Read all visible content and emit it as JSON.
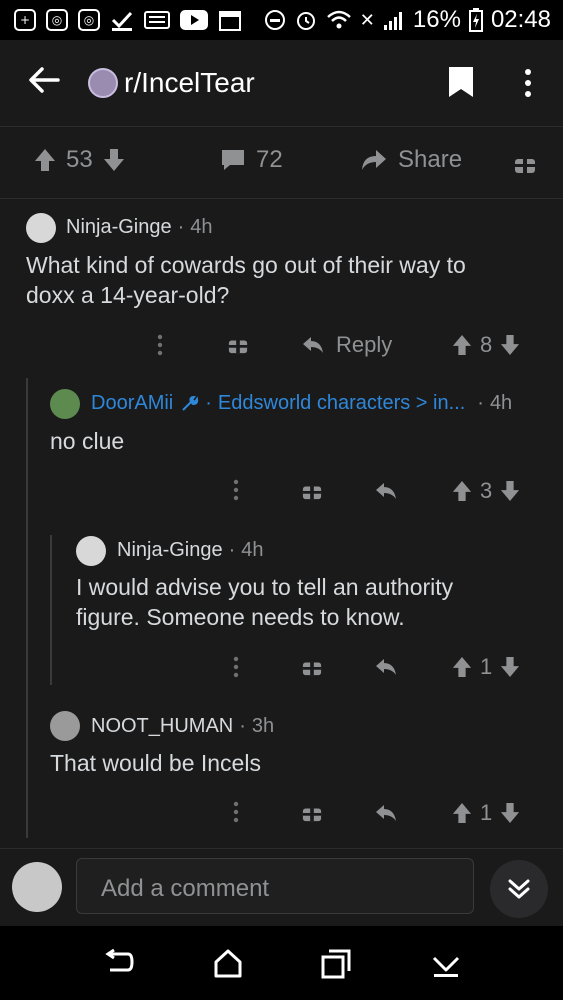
{
  "status_bar": {
    "battery": "16%",
    "time": "02:48",
    "x_mark": "✕"
  },
  "header": {
    "subreddit": "r/IncelTear",
    "bookmark_icon": "bookmark-icon",
    "more_icon": "more-icon"
  },
  "post_actions": {
    "upvotes": "53",
    "comments": "72",
    "share": "Share"
  },
  "comments": [
    {
      "author": "Ninja-Ginge",
      "sep": "·",
      "time": "4h",
      "body_lines": [
        "What kind of cowards go out of their way to",
        "doxx a 14-year-old?"
      ],
      "reply_label": "Reply",
      "score": "8"
    },
    {
      "author": "DoorAMii",
      "sep": "·",
      "flair": "Eddsworld characters > in...",
      "time": "4h",
      "body_lines": [
        "no clue"
      ],
      "score": "3"
    },
    {
      "author": "Ninja-Ginge",
      "sep": "·",
      "time": "4h",
      "body_lines": [
        "I would advise you to tell an authority",
        "figure. Someone needs to know."
      ],
      "score": "1"
    },
    {
      "author": "NOOT_HUMAN",
      "sep": "·",
      "time": "3h",
      "body_lines": [
        "That would be Incels"
      ],
      "score": "1"
    }
  ],
  "composer": {
    "placeholder": "Add a comment"
  },
  "colors": {
    "background": "#1a1a1b",
    "text": "#d7dadc",
    "muted": "#8f9193",
    "flair": "#2f87d9"
  }
}
